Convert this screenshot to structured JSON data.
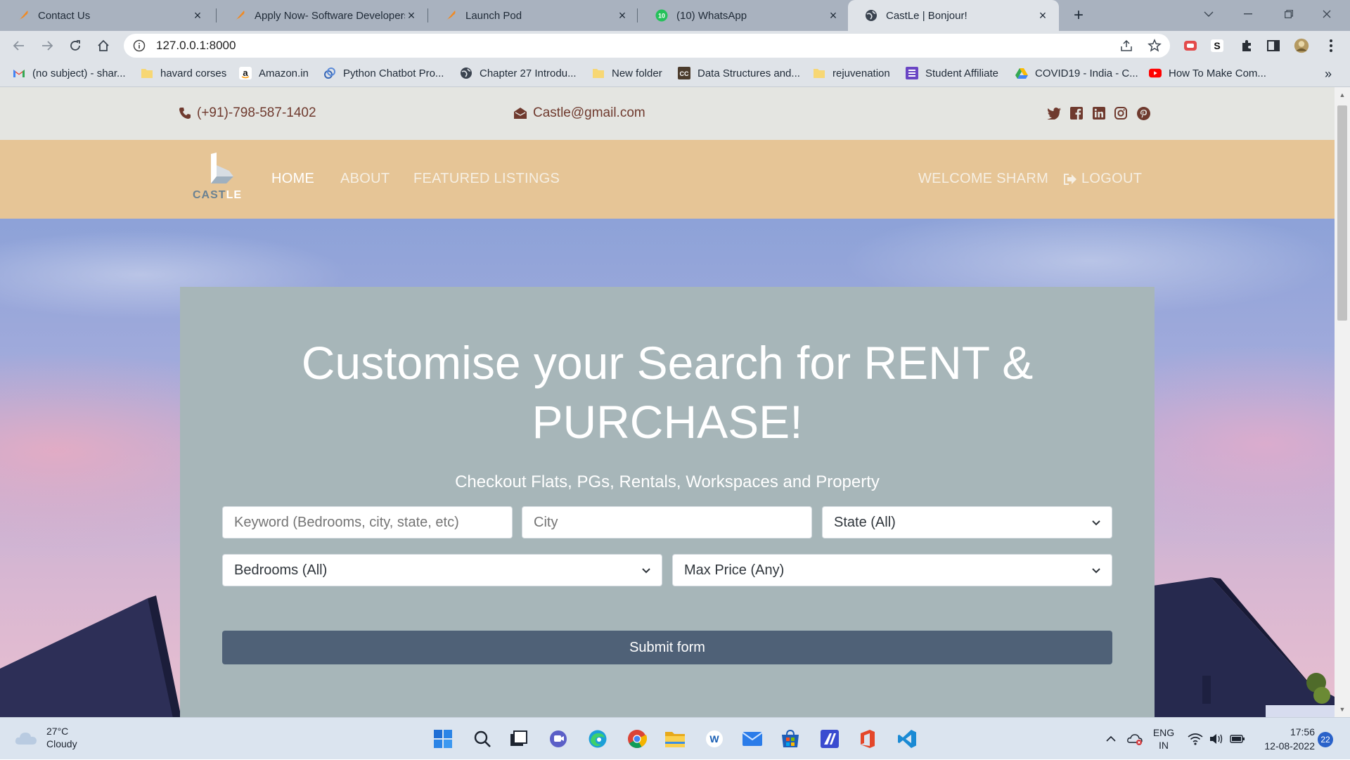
{
  "browser": {
    "tabs": [
      {
        "title": "Contact Us",
        "icon": "feather-icon"
      },
      {
        "title": "Apply Now- Software Developers",
        "icon": "feather-icon"
      },
      {
        "title": "Launch Pod",
        "icon": "feather-icon"
      },
      {
        "title": "(10) WhatsApp",
        "icon": "whatsapp-icon",
        "badge": "10"
      },
      {
        "title": "CastLe | Bonjour!",
        "icon": "globe-icon",
        "active": true
      }
    ],
    "url": "127.0.0.1:8000",
    "bookmarks": [
      {
        "label": "(no subject) - shar...",
        "icon": "gmail-icon"
      },
      {
        "label": "havard corses",
        "icon": "folder-icon"
      },
      {
        "label": "Amazon.in",
        "icon": "amazon-icon"
      },
      {
        "label": "Python Chatbot Pro...",
        "icon": "link-icon"
      },
      {
        "label": "Chapter 27 Introdu...",
        "icon": "globe-icon"
      },
      {
        "label": "New folder",
        "icon": "folder-icon"
      },
      {
        "label": "Data Structures and...",
        "icon": "cc-icon"
      },
      {
        "label": "rejuvenation",
        "icon": "folder-icon"
      },
      {
        "label": "Student Affiliate",
        "icon": "list-icon"
      },
      {
        "label": "COVID19 - India - C...",
        "icon": "drive-icon"
      },
      {
        "label": "How To Make Com...",
        "icon": "youtube-icon"
      }
    ],
    "overflow_label": "»"
  },
  "site": {
    "topbar": {
      "phone": "(+91)-798-587-1402",
      "email": "Castle@gmail.com",
      "socials": [
        "twitter-icon",
        "facebook-icon",
        "linkedin-icon",
        "instagram-icon",
        "pinterest-icon"
      ]
    },
    "logo": {
      "part1": "CAST",
      "part2": "LE"
    },
    "nav": {
      "home": "HOME",
      "about": "ABOUT",
      "listings": "FEATURED LISTINGS",
      "welcome": "WELCOME SHARM",
      "logout": "LOGOUT"
    },
    "search": {
      "title": "Customise your Search for RENT & PURCHASE!",
      "subtitle": "Checkout Flats, PGs, Rentals, Workspaces and Property",
      "keyword_placeholder": "Keyword (Bedrooms, city, state, etc)",
      "city_placeholder": "City",
      "state_value": "State (All)",
      "bedrooms_value": "Bedrooms (All)",
      "price_value": "Max Price (Any)",
      "submit_label": "Submit form"
    }
  },
  "taskbar": {
    "weather": {
      "temp": "27°C",
      "condition": "Cloudy"
    },
    "lang": {
      "line1": "ENG",
      "line2": "IN"
    },
    "time": "17:56",
    "date": "12-08-2022",
    "notifications": "22"
  },
  "colors": {
    "topbar_bg": "#e4e5e1",
    "navbar_bg": "#e6c596",
    "card_bg": "#a7b6b9",
    "button_bg": "#4f6177",
    "accent_brown": "#6f3a2e"
  }
}
